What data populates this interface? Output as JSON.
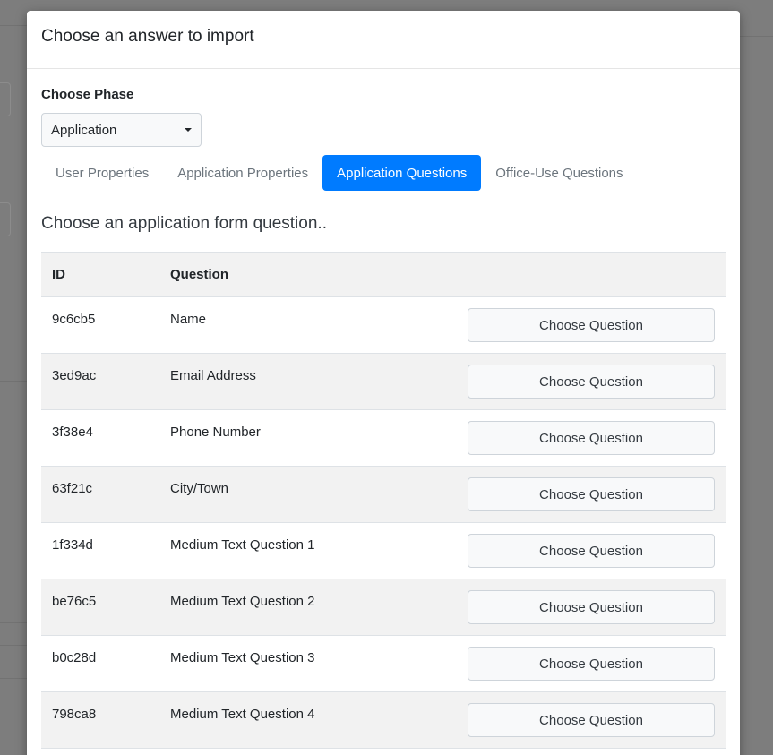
{
  "modal": {
    "title": "Choose an answer to import",
    "phase_label": "Choose Phase",
    "phase_selected": "Application",
    "tabs": [
      {
        "label": "User Properties",
        "active": false
      },
      {
        "label": "Application Properties",
        "active": false
      },
      {
        "label": "Application Questions",
        "active": true
      },
      {
        "label": "Office-Use Questions",
        "active": false
      }
    ],
    "prompt": "Choose an application form question..",
    "table": {
      "headers": {
        "id": "ID",
        "question": "Question"
      },
      "button_label": "Choose Question",
      "rows": [
        {
          "id": "9c6cb5",
          "question": "Name"
        },
        {
          "id": "3ed9ac",
          "question": "Email Address"
        },
        {
          "id": "3f38e4",
          "question": "Phone Number"
        },
        {
          "id": "63f21c",
          "question": "City/Town"
        },
        {
          "id": "1f334d",
          "question": "Medium Text Question 1"
        },
        {
          "id": "be76c5",
          "question": "Medium Text Question 2"
        },
        {
          "id": "b0c28d",
          "question": "Medium Text Question 3"
        },
        {
          "id": "798ca8",
          "question": "Medium Text Question 4"
        }
      ]
    }
  },
  "colors": {
    "accent": "#007bff",
    "overlay": "#7f7f7f",
    "row_stripe": "#f2f2f2"
  },
  "icons": {
    "select_caret": "caret-down-icon"
  }
}
